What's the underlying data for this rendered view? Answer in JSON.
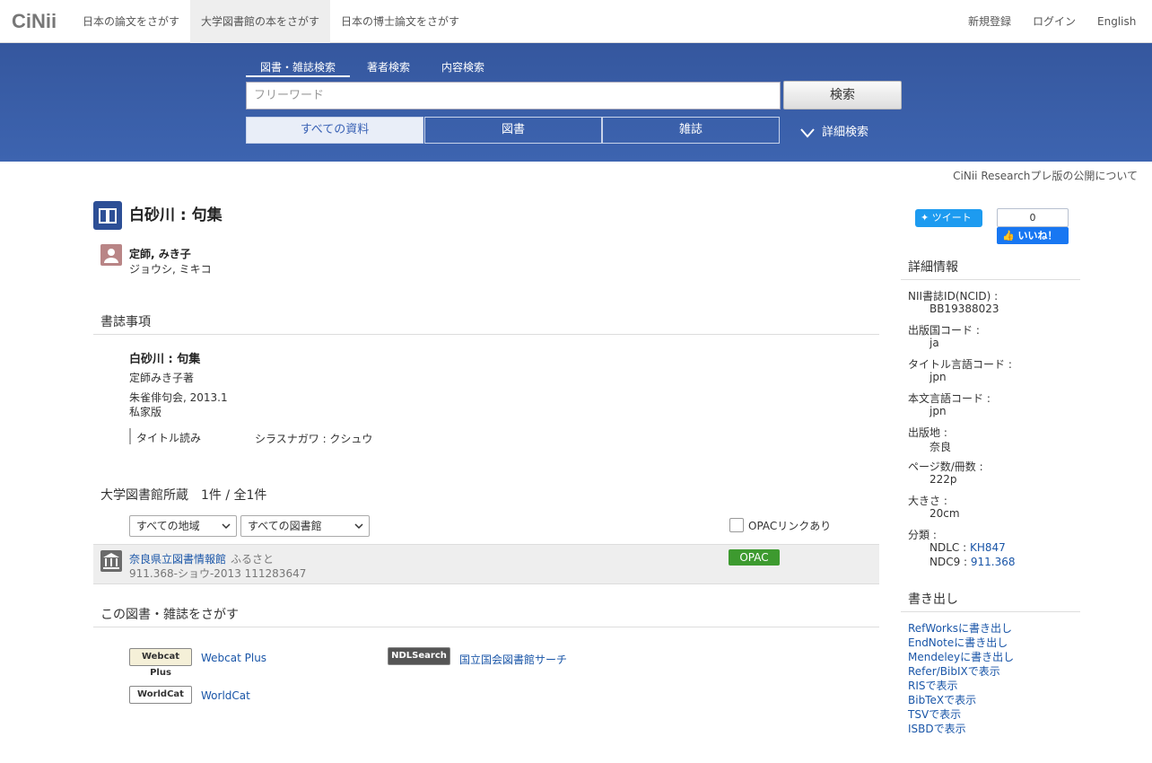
{
  "nav": {
    "logo": "CiNii",
    "links": [
      "日本の論文をさがす",
      "大学図書館の本をさがす",
      "日本の博士論文をさがす"
    ],
    "right": [
      "新規登録",
      "ログイン",
      "English"
    ]
  },
  "search": {
    "tabs": [
      "図書・雑誌検索",
      "著者検索",
      "内容検索"
    ],
    "placeholder": "フリーワード",
    "button": "検索",
    "scopes": [
      "すべての資料",
      "図書",
      "雑誌"
    ],
    "advanced": "詳細検索"
  },
  "prerelease": "CiNii Researchプレ版の公開について",
  "book": {
    "title": "白砂川 : 句集",
    "author": "定師, みき子",
    "author_kana": "ジョウシ, ミキコ"
  },
  "bibliographic": {
    "heading": "書誌事項",
    "title": "白砂川 : 句集",
    "responsibility": "定師みき子著",
    "publisher": "朱雀俳句会, 2013.1",
    "edition": "私家版",
    "reading_label": "タイトル読み",
    "reading_value": "シラスナガワ : クシュウ"
  },
  "holdings": {
    "heading": "大学図書館所蔵　1件 / 全1件",
    "region_select": "すべての地域",
    "library_select": "すべての図書館",
    "opac_checkbox": "OPACリンクあり",
    "library": "奈良県立図書情報館",
    "library_sub": "ふるさと",
    "callno": "911.368-ショウ-2013  111283647",
    "opac_button": "OPAC"
  },
  "search_elsewhere": {
    "heading": "この図書・雑誌をさがす",
    "links": [
      {
        "logo": "Webcat Plus",
        "label": "Webcat Plus"
      },
      {
        "logo": "NDLSearch",
        "label": "国立国会図書館サーチ"
      },
      {
        "logo": "WorldCat",
        "label": "WorldCat"
      }
    ]
  },
  "social": {
    "tweet": "ツイート",
    "fb_count": "0",
    "fb_like": "いいね！"
  },
  "details": {
    "heading": "詳細情報",
    "items": [
      {
        "key": "NII書誌ID(NCID) :",
        "value": "BB19388023"
      },
      {
        "key": "出版国コード :",
        "value": "ja"
      },
      {
        "key": "タイトル言語コード :",
        "value": "jpn"
      },
      {
        "key": "本文言語コード :",
        "value": "jpn"
      },
      {
        "key": "出版地 :",
        "value": "奈良"
      },
      {
        "key": "ページ数/冊数 :",
        "value": "222p"
      },
      {
        "key": "大きさ :",
        "value": "20cm"
      }
    ],
    "class_key": "分類 :",
    "ndlc_label": "NDLC : ",
    "ndlc_value": "KH847",
    "ndc9_label": "NDC9 : ",
    "ndc9_value": "911.368"
  },
  "export": {
    "heading": "書き出し",
    "links": [
      "RefWorksに書き出し",
      "EndNoteに書き出し",
      "Mendeleyに書き出し",
      "Refer/BibIXで表示",
      "RISで表示",
      "BibTeXで表示",
      "TSVで表示",
      "ISBDで表示"
    ]
  },
  "colors": {
    "band": "#3d64b0",
    "link": "#1a56a8",
    "opac": "#3d9a2f"
  }
}
